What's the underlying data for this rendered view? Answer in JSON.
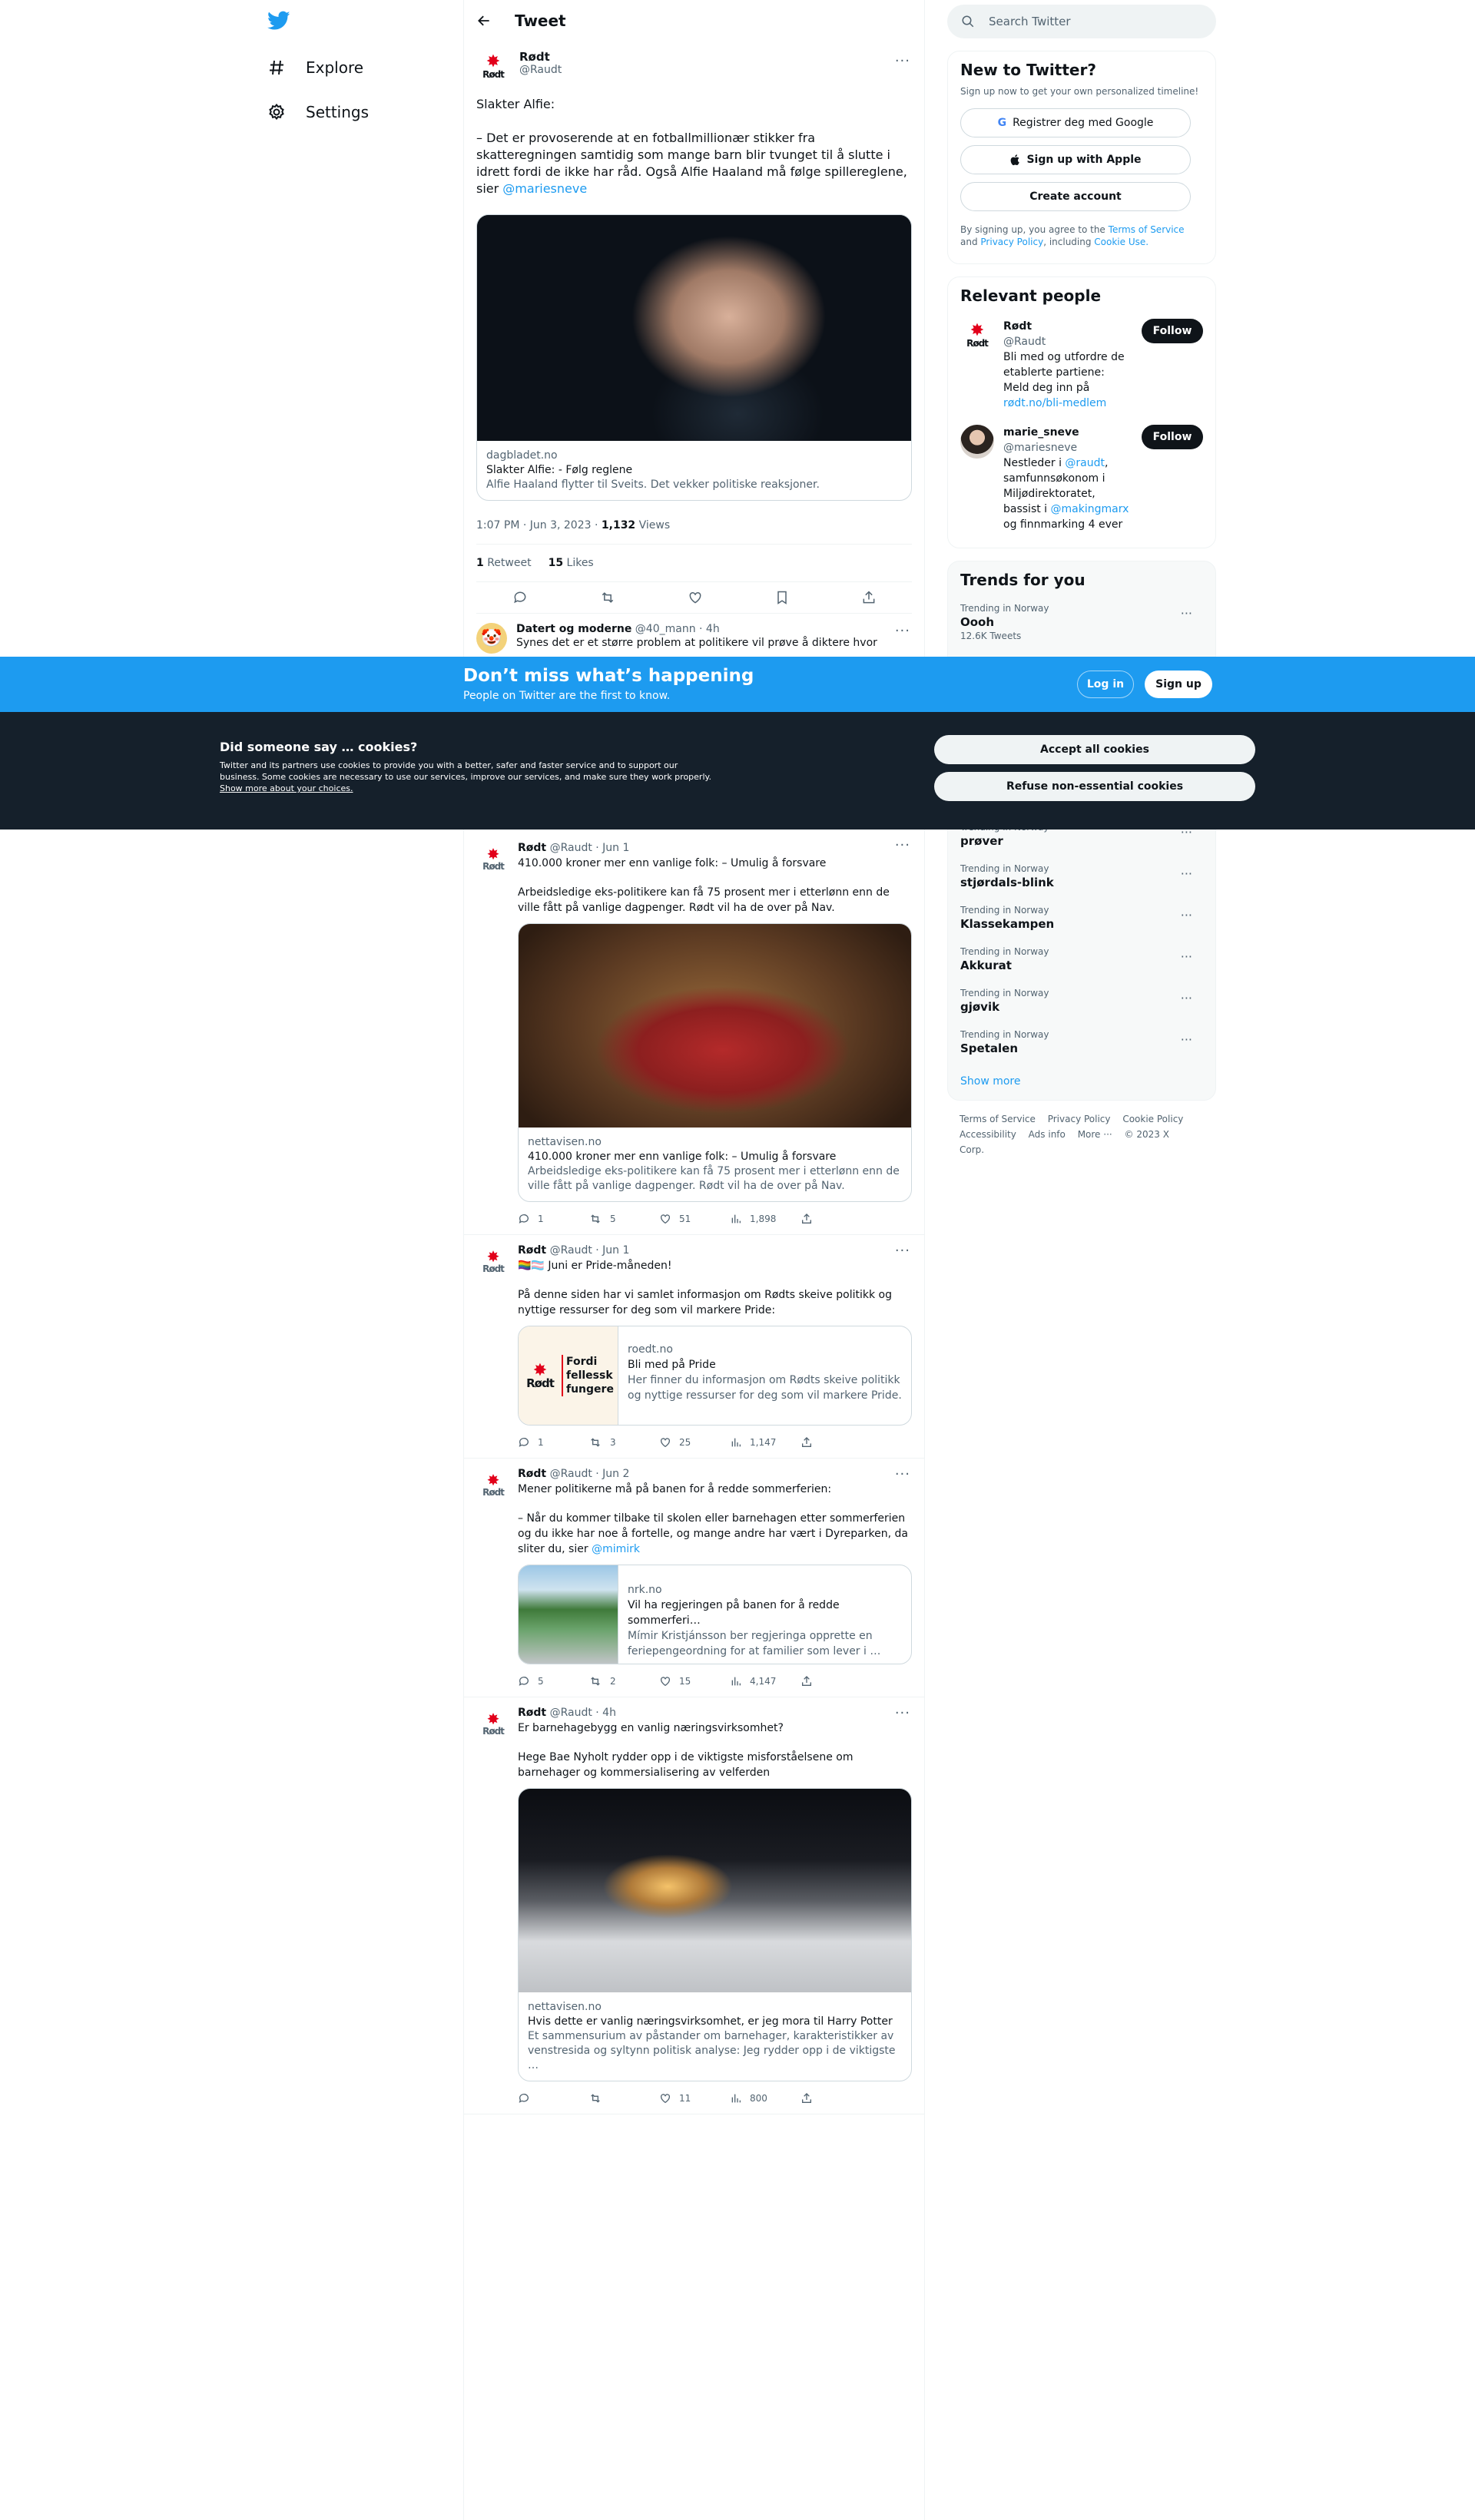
{
  "nav": {
    "explore": "Explore",
    "settings": "Settings"
  },
  "header": {
    "title": "Tweet"
  },
  "main_tweet": {
    "name": "Rødt",
    "handle": "@Raudt",
    "logo_word": "Rødt",
    "text_1": "Slakter Alfie:",
    "text_2": "– Det er provoserende at en fotballmillionær stikker fra skatteregningen samtidig som mange barn blir tvunget til å slutte i idrett fordi de ikke har råd. Også Alfie Haaland må følge spillereglene, sier",
    "mention": "@mariesneve",
    "card": {
      "domain": "dagbladet.no",
      "title": "Slakter Alfie: - Følg reglene",
      "desc": "Alfie Haaland flytter til Sveits. Det vekker politiske reaksjoner."
    },
    "time": "1:07 PM · Jun 3, 2023",
    "views_count": "1,132",
    "views_label": "Views",
    "retweets_count": "1",
    "retweets_label": "Retweet",
    "likes_count": "15",
    "likes_label": "Likes"
  },
  "reply": {
    "name": "Datert og moderne",
    "handle": "@40_mann",
    "age": "· 4h",
    "text": "Synes det er et større problem at politikere vil prøve å diktere hvor"
  },
  "banner": {
    "headline": "Don’t miss what’s happening",
    "sub": "People on Twitter are the first to know.",
    "login": "Log in",
    "signup": "Sign up"
  },
  "cookie": {
    "title": "Did someone say … cookies?",
    "text": "Twitter and its partners use cookies to provide you with a better, safer and faster service and to support our business. Some cookies are necessary to use our services, improve our services, and make sure they work properly.",
    "link": "Show more about your choices.",
    "accept": "Accept all cookies",
    "refuse": "Refuse non-essential cookies"
  },
  "timeline": [
    {
      "name": "Rødt",
      "handle": "@Raudt",
      "date": "· Jun 1",
      "text_1": "410.000 kroner mer enn vanlige folk: – Umulig å forsvare",
      "text_2": "Arbeidsledige eks-politikere kan få 75 prosent mer i etterlønn enn de ville fått på vanlige dagpenger. Rødt vil ha de over på Nav.",
      "card_domain": "nettavisen.no",
      "card_title": "410.000 kroner mer enn vanlige folk: – Umulig å forsvare",
      "card_desc": "Arbeidsledige eks-politikere kan få 75 prosent mer i etterlønn enn de ville fått på vanlige dagpenger. Rødt vil ha de over på Nav.",
      "replies": "1",
      "retweets": "5",
      "likes": "51",
      "views": "1,898"
    },
    {
      "name": "Rødt",
      "handle": "@Raudt",
      "date": "· Jun 1",
      "text_1": "🏳️‍🌈🏳️‍⚧️ Juni er Pride-måneden!",
      "text_2": "På denne siden har vi samlet  informasjon om Rødts skeive politikk og nyttige ressurser for deg som vil markere Pride:",
      "thumb_1": "Fordi",
      "thumb_2": "fellessk",
      "thumb_3": "fungere",
      "card_domain": "roedt.no",
      "card_title": "Bli med på Pride",
      "card_desc": "Her finner du informasjon om Rødts skeive politikk og nyttige ressurser for deg som vil markere Pride.",
      "replies": "1",
      "retweets": "3",
      "likes": "25",
      "views": "1,147"
    },
    {
      "name": "Rødt",
      "handle": "@Raudt",
      "date": "· Jun 2",
      "text_1": "Mener politikerne må på banen for å redde sommerferien:",
      "text_2": "– Når du kommer tilbake til skolen eller barnehagen etter sommerferien og du ikke har noe å fortelle, og mange andre har vært i Dyreparken, da sliter du, sier",
      "mention": "@mimirk",
      "card_domain": "nrk.no",
      "card_title": "Vil ha regjeringen på banen for å redde sommerferi…",
      "card_desc": "Mímir Kristjánsson ber regjeringa opprette en feriepengeordning for at familier som lever i …",
      "replies": "5",
      "retweets": "2",
      "likes": "15",
      "views": "4,147"
    },
    {
      "name": "Rødt",
      "handle": "@Raudt",
      "date": "· 4h",
      "text_1": "Er barnehagebygg en vanlig næringsvirksomhet?",
      "text_2": "Hege Bae Nyholt rydder opp i de viktigste misforståelsene om barnehager og kommersialisering av velferden",
      "card_domain": "nettavisen.no",
      "card_title": "Hvis dette er vanlig næringsvirksomhet, er jeg mora til Harry Potter",
      "card_desc": "Et sammensurium av påstander om barnehager, karakteristikker av venstresida og syltynn politisk analyse: Jeg rydder opp i de viktigste …",
      "replies": "",
      "retweets": "",
      "likes": "11",
      "views": "800"
    }
  ],
  "right": {
    "search_placeholder": "Search Twitter",
    "new_title": "New to Twitter?",
    "new_sub": "Sign up now to get your own personalized timeline!",
    "google": "Registrer deg med Google",
    "apple": "Sign up with Apple",
    "create": "Create account",
    "terms_1": "By signing up, you agree to the",
    "terms_link": "Terms of Service",
    "terms_2": "and",
    "privacy_link": "Privacy Policy",
    "terms_3": ", including",
    "cookie_link": "Cookie Use.",
    "relevant_title": "Relevant people",
    "people": [
      {
        "name": "Rødt",
        "handle": "@Raudt",
        "follow": "Follow",
        "bio_1": "Bli med og utfordre de etablerte partiene: Meld deg inn på",
        "bio_link": "rødt.no/bli-medlem",
        "bio_2": ""
      },
      {
        "name": "marie_sneve",
        "handle": "@mariesneve",
        "follow": "Follow",
        "bio_1": "Nestleder i",
        "bio_link": "@raudt",
        "bio_2": ", samfunnsøkonom i Miljødirektoratet, bassist i",
        "bio_link2": "@makingmarx",
        "bio_3": "og finnmarking 4 ever"
      }
    ],
    "trends_title": "Trends for you",
    "trends": [
      {
        "ctx": "Trending in Norway",
        "name": "Oooh",
        "count": "12.6K Tweets"
      },
      {
        "ctx": "Trending in Norway",
        "name": "prøver"
      },
      {
        "ctx": "Trending in Norway",
        "name": "stjørdals-blink"
      },
      {
        "ctx": "Trending in Norway",
        "name": "Klassekampen"
      },
      {
        "ctx": "Trending in Norway",
        "name": "Akkurat"
      },
      {
        "ctx": "Trending in Norway",
        "name": "gjøvik"
      },
      {
        "ctx": "Trending in Norway",
        "name": "Spetalen"
      }
    ],
    "show_more": "Show more",
    "footer": [
      "Terms of Service",
      "Privacy Policy",
      "Cookie Policy",
      "Accessibility",
      "Ads info",
      "More ···",
      "© 2023 X Corp."
    ]
  },
  "colors": {
    "accent": "#1d9bf0",
    "text": "#0f1419",
    "muted": "#536471",
    "rodt_red": "#e2001a",
    "cookie_bg": "#15202b"
  },
  "icons": [
    "twitter-bird-icon",
    "hashtag-icon",
    "gear-icon",
    "back-arrow-icon",
    "more-icon",
    "reply-icon",
    "retweet-icon",
    "like-icon",
    "bookmark-icon",
    "share-icon",
    "views-icon",
    "search-icon",
    "google-icon",
    "apple-icon"
  ]
}
